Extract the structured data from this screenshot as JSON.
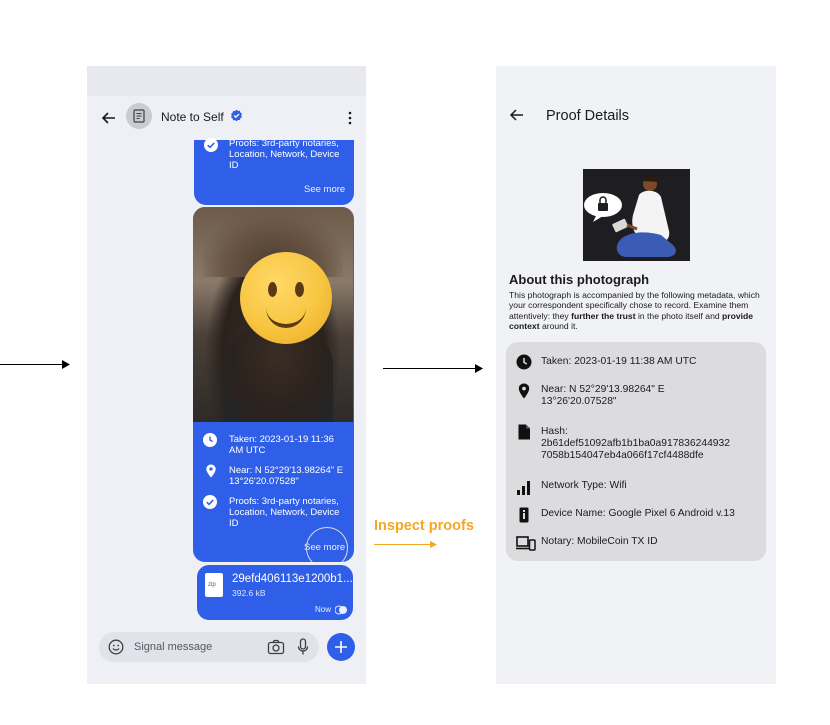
{
  "left_phone": {
    "header": {
      "title": "Note to Self",
      "verified_icon": "verified-badge-icon"
    },
    "top_bubble": {
      "proofs_text": "Proofs: 3rd-party notaries, Location, Network, Device ID",
      "see_more": "See more"
    },
    "photo_bubble": {
      "taken": "Taken: 2023-01-19 11:36 AM UTC",
      "near": "Near: N 52°29'13.98264\" E 13°26'20.07528\"",
      "proofs": "Proofs: 3rd-party notaries, Location, Network, Device ID",
      "see_more": "See more"
    },
    "file_bubble": {
      "file_type": "zip",
      "file_name": "29efd406113e1200b1...",
      "file_size": "392.6 kB",
      "timestamp": "Now"
    },
    "composer": {
      "placeholder": "Signal message"
    }
  },
  "annotation": {
    "label": "Inspect proofs",
    "color": "#f5a623"
  },
  "right_phone": {
    "title": "Proof Details",
    "about_title": "About this photograph",
    "about_text": {
      "p1": "This photograph is accompanied by the following metadata, which your correspondent specifically chose to record. Examine them attentively: they ",
      "b1": "further the trust",
      "p2": " in the photo itself and ",
      "b2": "provide context",
      "p3": " around it."
    },
    "details": [
      {
        "icon": "clock-icon",
        "text": "Taken: 2023-01-19 11:38 AM UTC"
      },
      {
        "icon": "location-pin-icon",
        "text": "Near: N 52°29'13.98264\" E 13°26'20.07528\""
      },
      {
        "icon": "document-icon",
        "text": "Hash: 2b61def51092afb1b1ba0a917836244932 7058b154047eb4a066f17cf4488dfe"
      },
      {
        "icon": "signal-bars-icon",
        "text": "Network Type: Wifi"
      },
      {
        "icon": "phone-info-icon",
        "text": "Device Name: Google Pixel 6 Android v.13"
      },
      {
        "icon": "devices-icon",
        "text": "Notary: MobileCoin TX ID"
      }
    ]
  },
  "colors": {
    "accent": "#2f5fe8",
    "card": "#dcdcde",
    "annotation": "#f5a623"
  }
}
